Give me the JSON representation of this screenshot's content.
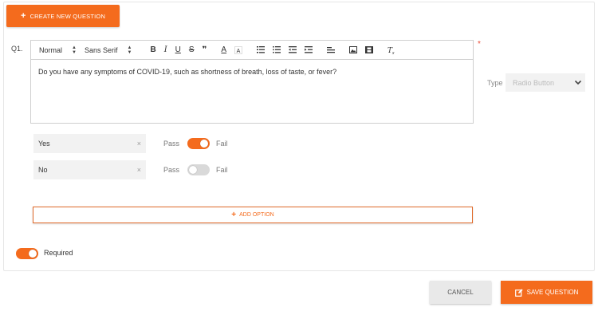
{
  "header": {
    "create_button_label": "CREATE NEW QUESTION"
  },
  "question": {
    "number": "Q1.",
    "text": "Do you have any symptoms of COVID-19, such as shortness of breath, loss of taste, or fever?",
    "required_marker": "*",
    "type_label": "Type",
    "type_value": "Radio Button"
  },
  "toolbar": {
    "size_value": "Normal",
    "font_value": "Sans Serif",
    "bold_glyph": "B",
    "italic_glyph": "I",
    "underline_glyph": "U",
    "strike_glyph": "S",
    "quote_glyph": "❞",
    "font_color_glyph": "A"
  },
  "options": [
    {
      "label": "Yes",
      "remove_glyph": "×",
      "pass_label": "Pass",
      "fail_label": "Fail",
      "is_pass": true
    },
    {
      "label": "No",
      "remove_glyph": "×",
      "pass_label": "Pass",
      "fail_label": "Fail",
      "is_pass": false
    }
  ],
  "add_option_label": "ADD OPTION",
  "required": {
    "label": "Required",
    "is_on": true
  },
  "footer": {
    "cancel_label": "CANCEL",
    "save_label": "SAVE QUESTION"
  },
  "colors": {
    "accent": "#f46b1d",
    "required_star": "#e94b35",
    "toggle_off": "#d9d9d9"
  }
}
